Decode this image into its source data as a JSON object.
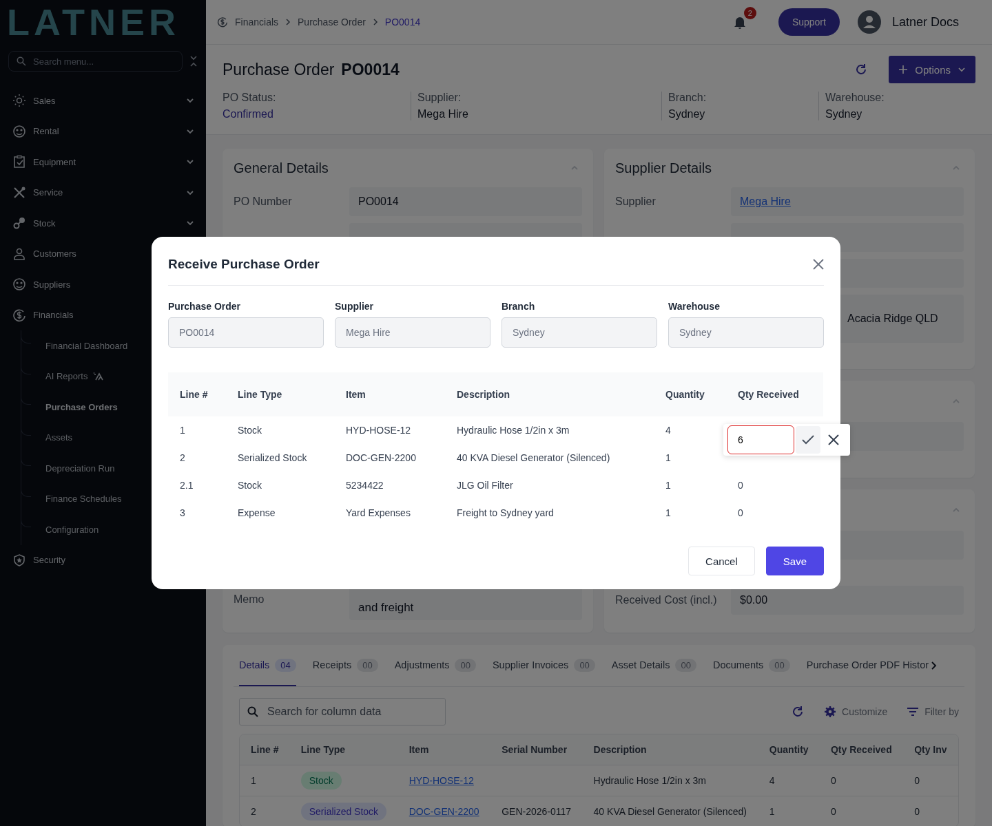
{
  "sidebar": {
    "logo": "LATNER",
    "search": {
      "placeholder": "Search menu..."
    },
    "items": [
      {
        "label": "Sales",
        "kind": "group",
        "expanded": false
      },
      {
        "label": "Rental",
        "kind": "group",
        "expanded": false
      },
      {
        "label": "Equipment",
        "kind": "group",
        "expanded": false
      },
      {
        "label": "Service",
        "kind": "group",
        "expanded": false
      },
      {
        "label": "Stock",
        "kind": "group",
        "expanded": false
      },
      {
        "label": "Customers",
        "kind": "link"
      },
      {
        "label": "Suppliers",
        "kind": "link"
      },
      {
        "label": "Financials",
        "kind": "group",
        "expanded": true,
        "children": [
          {
            "label": "Financial Dashboard",
            "selected": false
          },
          {
            "label": "AI Reports",
            "selected": false,
            "kind": "ai"
          },
          {
            "label": "Purchase Orders",
            "selected": true
          },
          {
            "label": "Assets",
            "selected": false
          },
          {
            "label": "Depreciation Run",
            "selected": false
          },
          {
            "label": "Finance Schedules",
            "selected": false
          },
          {
            "label": "Configuration",
            "selected": false
          }
        ]
      },
      {
        "label": "Security",
        "kind": "link"
      }
    ]
  },
  "header": {
    "breadcrumb": [
      {
        "label": "Financials",
        "current": false
      },
      {
        "label": "Purchase Order",
        "current": false
      },
      {
        "label": "PO0014",
        "current": true
      }
    ],
    "notifications": "2",
    "support_button": "Support",
    "user": "Latner Docs"
  },
  "page": {
    "title": "Purchase Order",
    "number": "PO0014",
    "options_button": "Options",
    "summary": [
      {
        "label": "PO Status:",
        "value": "Confirmed",
        "kind": "status"
      },
      {
        "label": "Supplier:",
        "value": "Mega Hire",
        "kind": "text"
      },
      {
        "label": "Branch:",
        "value": "Sydney",
        "kind": "text"
      },
      {
        "label": "Warehouse:",
        "value": "Sydney",
        "kind": "text"
      }
    ]
  },
  "general_details": {
    "title": "General Details",
    "expanded": true,
    "fields": [
      {
        "label": "PO Number",
        "value": "PO0014"
      }
    ],
    "memo": {
      "label": "Memo",
      "value": "and freight"
    }
  },
  "supplier_details": {
    "title": "Supplier Details",
    "expanded": true,
    "fields": [
      {
        "label": "Supplier",
        "value": "Mega Hire",
        "kind": "link"
      }
    ],
    "address": "Acacia Ridge QLD"
  },
  "panels": [
    {
      "expanded": true
    },
    {
      "expanded": true,
      "fields": [
        {
          "label": "Received Cost (incl.)",
          "value": "$0.00"
        }
      ]
    }
  ],
  "tabs_panel": {
    "tabs": [
      {
        "label": "Details",
        "count": "04",
        "selected": true
      },
      {
        "label": "Receipts",
        "count": "00",
        "selected": false
      },
      {
        "label": "Adjustments",
        "count": "00",
        "selected": false
      },
      {
        "label": "Supplier Invoices",
        "count": "00",
        "selected": false
      },
      {
        "label": "Asset Details",
        "count": "00",
        "selected": false
      },
      {
        "label": "Documents",
        "count": "00",
        "selected": false
      },
      {
        "label": "Purchase Order PDF Histor",
        "selected": false
      }
    ],
    "search": {
      "placeholder": "Search for column data"
    },
    "actions": [
      "Customize",
      "Filter by"
    ],
    "table": {
      "columns": [
        "Line #",
        "Line Type",
        "Item",
        "Serial Number",
        "Description",
        "Quantity",
        "Qty Received",
        "Qty Inv"
      ],
      "rows": [
        {
          "line": "1",
          "line_type": "Stock",
          "kind": "stock",
          "item": "HYD-HOSE-12",
          "description": "Hydraulic Hose 1/2in x 3m",
          "quantity": "4",
          "qty_received": "0",
          "qty_invoiced": "0"
        },
        {
          "line": "2",
          "line_type": "Serialized Stock",
          "kind": "serialized",
          "item": "DOC-GEN-2200",
          "serial": "GEN-2026-0117",
          "description": "40 KVA Diesel Generator (Silenced)",
          "quantity": "1",
          "qty_received": "0",
          "qty_invoiced": "0"
        }
      ]
    }
  },
  "modal": {
    "title": "Receive Purchase Order",
    "fields": [
      {
        "label": "Purchase Order",
        "value": "PO0014",
        "disabled": true
      },
      {
        "label": "Supplier",
        "value": "Mega Hire",
        "disabled": true
      },
      {
        "label": "Branch",
        "value": "Sydney",
        "disabled": true
      },
      {
        "label": "Warehouse",
        "value": "Sydney",
        "disabled": true
      }
    ],
    "table": {
      "columns": [
        "Line #",
        "Line Type",
        "Item",
        "Description",
        "Quantity",
        "Qty Received"
      ],
      "rows": [
        {
          "line": "1",
          "line_type": "Stock",
          "item": "HYD-HOSE-12",
          "description": "Hydraulic Hose 1/2in x 3m",
          "quantity": "4",
          "editing": true
        },
        {
          "line": "2",
          "line_type": "Serialized Stock",
          "item": "DOC-GEN-2200",
          "description": "40 KVA Diesel Generator (Silenced)",
          "quantity": "1",
          "editing": false
        },
        {
          "line": "2.1",
          "line_type": "Stock",
          "item": "5234422",
          "description": "JLG Oil Filter",
          "quantity": "1",
          "qty_received": "0",
          "editing": false
        },
        {
          "line": "3",
          "line_type": "Expense",
          "item": "Yard Expenses",
          "description": "Freight to Sydney yard",
          "quantity": "1",
          "qty_received": "0",
          "editing": false
        }
      ]
    },
    "editor": {
      "value": "6",
      "invalid": true
    },
    "buttons": [
      {
        "label": "Cancel",
        "kind": "secondary"
      },
      {
        "label": "Save",
        "kind": "primary"
      }
    ]
  }
}
